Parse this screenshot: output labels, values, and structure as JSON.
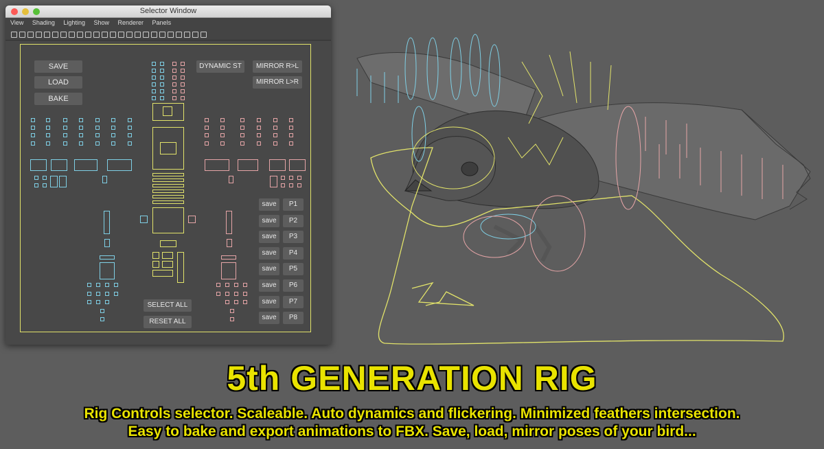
{
  "window": {
    "title": "Selector Window",
    "menus": [
      "View",
      "Shading",
      "Lighting",
      "Show",
      "Renderer",
      "Panels"
    ]
  },
  "selector": {
    "save_label": "SAVE",
    "load_label": "LOAD",
    "bake_label": "BAKE",
    "dynamic_label": "DYNAMIC ST",
    "mirror_rl_label": "MIRROR R>L",
    "mirror_lr_label": "MIRROR L>R",
    "select_all_label": "SELECT ALL",
    "reset_all_label": "RESET ALL",
    "poses": [
      {
        "save": "save",
        "pose": "P1"
      },
      {
        "save": "save",
        "pose": "P2"
      },
      {
        "save": "save",
        "pose": "P3"
      },
      {
        "save": "save",
        "pose": "P4"
      },
      {
        "save": "save",
        "pose": "P5"
      },
      {
        "save": "save",
        "pose": "P6"
      },
      {
        "save": "save",
        "pose": "P7"
      },
      {
        "save": "save",
        "pose": "P8"
      }
    ]
  },
  "colors": {
    "left_side": "#7fd0e6",
    "right_side": "#e6a5a7",
    "center": "#e2e36a",
    "caption": "#e9e300"
  },
  "caption": {
    "headline": "5th GENERATION RIG",
    "line1": "Rig Controls selector. Scaleable. Auto dynamics and flickering. Minimized feathers intersection.",
    "line2": "Easy to bake and export animations to FBX. Save, load, mirror poses of your bird..."
  }
}
